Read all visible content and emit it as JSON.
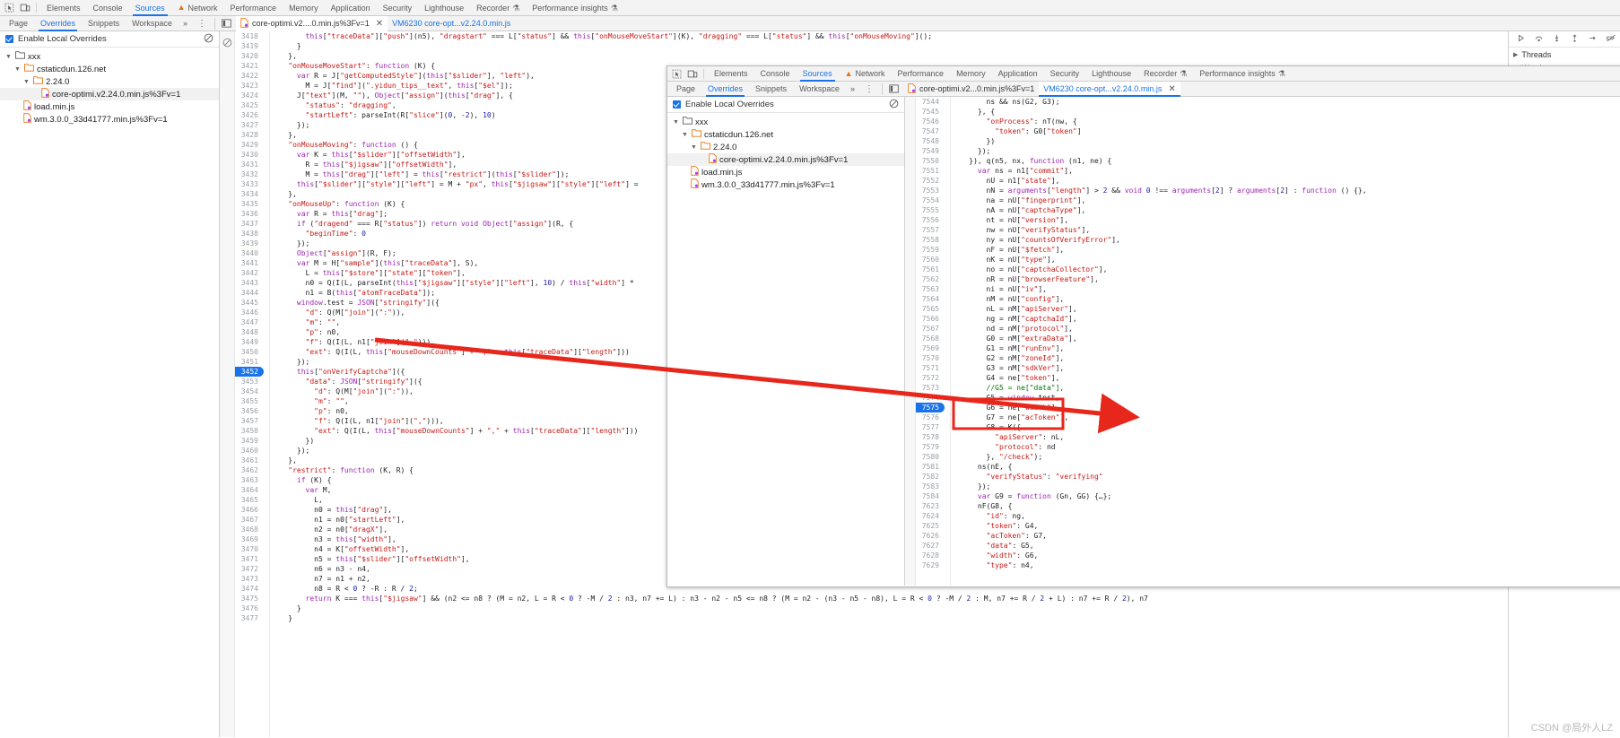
{
  "outer": {
    "toolbar": {
      "inspect_icon": "inspect-element-icon",
      "device_icon": "device-toolbar-icon",
      "tabs": [
        {
          "label": "Elements",
          "active": false
        },
        {
          "label": "Console",
          "active": false
        },
        {
          "label": "Sources",
          "active": true
        },
        {
          "label": "Network",
          "active": false,
          "warn": true
        },
        {
          "label": "Performance",
          "active": false
        },
        {
          "label": "Memory",
          "active": false
        },
        {
          "label": "Application",
          "active": false
        },
        {
          "label": "Security",
          "active": false
        },
        {
          "label": "Lighthouse",
          "active": false
        },
        {
          "label": "Recorder",
          "active": false,
          "flask": true
        },
        {
          "label": "Performance insights",
          "active": false,
          "flask": true
        }
      ]
    },
    "subbar": {
      "tabs": [
        {
          "label": "Page",
          "active": false
        },
        {
          "label": "Overrides",
          "active": true
        },
        {
          "label": "Snippets",
          "active": false
        },
        {
          "label": "Workspace",
          "active": false
        }
      ],
      "more": "»",
      "kebab": "⋮",
      "file_tabs": [
        {
          "label": "core-optimi.v2....0.min.js%3Fv=1",
          "active": true,
          "closable": true
        },
        {
          "label": "VM6230 core-opt...v2.24.0.min.js",
          "active": false,
          "closable": false
        }
      ]
    },
    "navigator": {
      "enable_overrides_label": "Enable Local Overrides",
      "enable_overrides_checked": true,
      "clear_icon": "clear-configuration-icon",
      "tree": [
        {
          "depth": 0,
          "label": "xxx",
          "type": "folder",
          "expanded": true
        },
        {
          "depth": 1,
          "label": "cstaticdun.126.net",
          "type": "folder",
          "expanded": true
        },
        {
          "depth": 2,
          "label": "2.24.0",
          "type": "folder",
          "expanded": true
        },
        {
          "depth": 3,
          "label": "core-optimi.v2.24.0.min.js%3Fv=1",
          "type": "file",
          "selected": true
        },
        {
          "depth": 2,
          "label": "load.min.js",
          "type": "file",
          "selected": false
        },
        {
          "depth": 2,
          "label": "wm.3.0.0_33d41777.min.js%3Fv=1",
          "type": "file",
          "selected": false
        }
      ]
    },
    "editor": {
      "first_line": 3418,
      "current_line": 3452,
      "lines": [
        "        this[\"traceData\"][\"push\"](n5), \"dragstart\" === L[\"status\"] && this[\"onMouseMoveStart\"](K), \"dragging\" === L[\"status\"] && this[\"onMouseMoving\"]();",
        "      }",
        "    },",
        "    \"onMouseMoveStart\": function (K) {",
        "      var R = J[\"getComputedStyle\"](this[\"$slider\"], \"left\"),",
        "        M = J[\"find\"](\".yidun_tips__text\", this[\"$el\"]);",
        "      J[\"text\"](M, \"\"), Object[\"assign\"](this[\"drag\"], {",
        "        \"status\": \"dragging\",",
        "        \"startLeft\": parseInt(R[\"slice\"](0, -2), 10)",
        "      });",
        "    },",
        "    \"onMouseMoving\": function () {",
        "      var K = this[\"$slider\"][\"offsetWidth\"],",
        "        R = this[\"$jigsaw\"][\"offsetWidth\"],",
        "        M = this[\"drag\"][\"left\"] = this[\"restrict\"](this[\"$slider\"]);",
        "      this[\"$slider\"][\"style\"][\"left\"] = M + \"px\", this[\"$jigsaw\"][\"style\"][\"left\"] =",
        "    },",
        "    \"onMouseUp\": function (K) {",
        "      var R = this[\"drag\"];",
        "      if (\"dragend\" === R[\"status\"]) return void Object[\"assign\"](R, {",
        "        \"beginTime\": 0",
        "      });",
        "      Object[\"assign\"](R, F);",
        "      var M = H[\"sample\"](this[\"traceData\"], S),",
        "        L = this[\"$store\"][\"state\"][\"token\"],",
        "        n0 = Q(I(L, parseInt(this[\"$jigsaw\"][\"style\"][\"left\"], 10) / this[\"width\"] *",
        "        n1 = B(this[\"atomTraceData\"]);",
        "      window.test = JSON[\"stringify\"]({",
        "        \"d\": Q(M[\"join\"](\":\")),",
        "        \"m\": \"\",",
        "        \"p\": n0,",
        "        \"f\": Q(I(L, n1[\"join\"](\",\"))),",
        "        \"ext\": Q(I(L, this[\"mouseDownCounts\"] + \",\" + this[\"traceData\"][\"length\"]))",
        "      });",
        "      this[\"onVerifyCaptcha\"]({",
        "        \"data\": JSON[\"stringify\"]({",
        "          \"d\": Q(M[\"join\"](\":\")),",
        "          \"m\": \"\",",
        "          \"p\": n0,",
        "          \"f\": Q(I(L, n1[\"join\"](\",\"))),",
        "          \"ext\": Q(I(L, this[\"mouseDownCounts\"] + \",\" + this[\"traceData\"][\"length\"]))",
        "        })",
        "      });",
        "    },",
        "    \"restrict\": function (K, R) {",
        "      if (K) {",
        "        var M,",
        "          L,",
        "          n0 = this[\"drag\"],",
        "          n1 = n0[\"startLeft\"],",
        "          n2 = n0[\"dragX\"],",
        "          n3 = this[\"width\"],",
        "          n4 = K[\"offsetWidth\"],",
        "          n5 = this[\"$slider\"][\"offsetWidth\"],",
        "          n6 = n3 - n4,",
        "          n7 = n1 + n2,",
        "          n8 = R < 0 ? -R : R / 2;",
        "        return K === this[\"$jigsaw\"] && (n2 <= n8 ? (M = n2, L = R < 0 ? -M / 2 : n3, n7 += L) : n3 - n2 - n5 <= n8 ? (M = n2 - (n3 - n5 - n8), L = R < 0 ? -M / 2 : M, n7 += R / 2 + L) : n7 += R / 2), n7",
        "      }",
        "    }"
      ]
    },
    "right_rail": {
      "debug_icons": [
        "resume-icon",
        "step-over-icon",
        "step-into-icon",
        "step-out-icon",
        "step-icon",
        "deactivate-breakpoints-icon"
      ],
      "sections": [
        {
          "label": "Threads",
          "expanded": false
        },
        {
          "label": "Watch",
          "expanded": false
        }
      ]
    }
  },
  "inner": {
    "toolbar": {
      "inspect_icon": "inspect-element-icon",
      "device_icon": "device-toolbar-icon",
      "tabs": [
        {
          "label": "Elements",
          "active": false
        },
        {
          "label": "Console",
          "active": false
        },
        {
          "label": "Sources",
          "active": true
        },
        {
          "label": "Network",
          "active": false,
          "warn": true
        },
        {
          "label": "Performance",
          "active": false
        },
        {
          "label": "Memory",
          "active": false
        },
        {
          "label": "Application",
          "active": false
        },
        {
          "label": "Security",
          "active": false
        },
        {
          "label": "Lighthouse",
          "active": false
        },
        {
          "label": "Recorder",
          "active": false,
          "flask": true
        },
        {
          "label": "Performance insights",
          "active": false,
          "flask": true
        }
      ]
    },
    "subbar": {
      "tabs": [
        {
          "label": "Page",
          "active": false
        },
        {
          "label": "Overrides",
          "active": true
        },
        {
          "label": "Snippets",
          "active": false
        },
        {
          "label": "Workspace",
          "active": false
        }
      ],
      "more": "»",
      "kebab": "⋮",
      "file_tabs": [
        {
          "label": "core-optimi.v2...0.min.js%3Fv=1",
          "active": false,
          "closable": false
        },
        {
          "label": "VM6230 core-opt...v2.24.0.min.js",
          "active": true,
          "closable": true
        }
      ]
    },
    "navigator": {
      "enable_overrides_label": "Enable Local Overrides",
      "enable_overrides_checked": true,
      "clear_icon": "clear-configuration-icon",
      "tree": [
        {
          "depth": 0,
          "label": "xxx",
          "type": "folder",
          "expanded": true
        },
        {
          "depth": 1,
          "label": "cstaticdun.126.net",
          "type": "folder",
          "expanded": true
        },
        {
          "depth": 2,
          "label": "2.24.0",
          "type": "folder",
          "expanded": true
        },
        {
          "depth": 3,
          "label": "core-optimi.v2.24.0.min.js%3Fv=1",
          "type": "file",
          "selected": true
        },
        {
          "depth": 2,
          "label": "load.min.js",
          "type": "file",
          "selected": false
        },
        {
          "depth": 2,
          "label": "wm.3.0.0_33d41777.min.js%3Fv=1",
          "type": "file",
          "selected": false
        }
      ]
    },
    "editor": {
      "current_line": 7575,
      "rows": [
        {
          "num": 7544,
          "text": "        ns && ns(G2, G3);"
        },
        {
          "num": 7545,
          "text": "      }, {"
        },
        {
          "num": 7546,
          "text": "        \"onProcess\": nT(nw, {"
        },
        {
          "num": 7547,
          "text": "          \"token\": G0[\"token\"]"
        },
        {
          "num": 7548,
          "text": "        })"
        },
        {
          "num": 7549,
          "text": "      });"
        },
        {
          "num": 7550,
          "text": "    }), q(n5, nx, function (n1, ne) {"
        },
        {
          "num": 7551,
          "text": "      var ns = n1[\"commit\"],"
        },
        {
          "num": 7552,
          "text": "        nU = n1[\"state\"],"
        },
        {
          "num": 7553,
          "text": "        nN = arguments[\"length\"] > 2 && void 0 !== arguments[2] ? arguments[2] : function () {},"
        },
        {
          "num": 7554,
          "text": "        na = nU[\"fingerprint\"],"
        },
        {
          "num": 7555,
          "text": "        nA = nU[\"captchaType\"],"
        },
        {
          "num": 7556,
          "text": "        nt = nU[\"version\"],"
        },
        {
          "num": 7557,
          "text": "        nw = nU[\"verifyStatus\"],"
        },
        {
          "num": 7558,
          "text": "        ny = nU[\"countsOfVerifyError\"],"
        },
        {
          "num": 7559,
          "text": "        nF = nU[\"$fetch\"],"
        },
        {
          "num": 7560,
          "text": "        nK = nU[\"type\"],"
        },
        {
          "num": 7561,
          "text": "        no = nU[\"captchaCollector\"],"
        },
        {
          "num": 7562,
          "text": "        nR = nU[\"browserFeature\"],"
        },
        {
          "num": 7563,
          "text": "        ni = nU[\"iv\"],"
        },
        {
          "num": 7564,
          "text": "        nM = nU[\"config\"],"
        },
        {
          "num": 7565,
          "text": "        nL = nM[\"apiServer\"],"
        },
        {
          "num": 7566,
          "text": "        ng = nM[\"captchaId\"],"
        },
        {
          "num": 7567,
          "text": "        nd = nM[\"protocol\"],"
        },
        {
          "num": 7568,
          "text": "        G0 = nM[\"extraData\"],"
        },
        {
          "num": 7569,
          "text": "        G1 = nM[\"runEnv\"],"
        },
        {
          "num": 7570,
          "text": "        G2 = nM[\"zoneId\"],"
        },
        {
          "num": 7571,
          "text": "        G3 = nM[\"sdkVer\"],"
        },
        {
          "num": 7572,
          "text": "        G4 = ne[\"token\"],"
        },
        {
          "num": 7573,
          "text": "        //G5 = ne[\"data\"],",
          "highlight": true
        },
        {
          "num": 7574,
          "text": "        G5 = window.test,",
          "highlight": true
        },
        {
          "num": 7575,
          "text": "        G6 = ne[\"width\"],",
          "highlight": true,
          "current": true
        },
        {
          "num": 7576,
          "text": "        G7 = ne[\"acToken\"],"
        },
        {
          "num": 7577,
          "text": "        G8 = K({"
        },
        {
          "num": 7578,
          "text": "          \"apiServer\": nL,"
        },
        {
          "num": 7579,
          "text": "          \"protocol\": nd"
        },
        {
          "num": 7580,
          "text": "        }, \"/check\");"
        },
        {
          "num": 7581,
          "text": "      ns(nE, {"
        },
        {
          "num": 7582,
          "text": "        \"verifyStatus\": \"verifying\""
        },
        {
          "num": 7583,
          "text": "      });"
        },
        {
          "num": 7584,
          "text": "      var G9 = function (Gn, GG) {…};",
          "foldmark": true
        },
        {
          "num": 7623,
          "text": "      nF(G8, {"
        },
        {
          "num": 7624,
          "text": "        \"id\": ng,"
        },
        {
          "num": 7625,
          "text": "        \"token\": G4,"
        },
        {
          "num": 7626,
          "text": "        \"acToken\": G7,"
        },
        {
          "num": 7627,
          "text": "        \"data\": G5,",
          "boxed_key": true
        },
        {
          "num": 7628,
          "text": "        \"width\": G6,"
        },
        {
          "num": 7629,
          "text": "        \"type\": n4,"
        }
      ]
    }
  },
  "annotation": {
    "arrow_color": "#e8271c",
    "box_color": "#e8271c",
    "description": "red-arrow-from-window-test-to-G5-assignment"
  },
  "watermark": "CSDN @局外人LZ"
}
